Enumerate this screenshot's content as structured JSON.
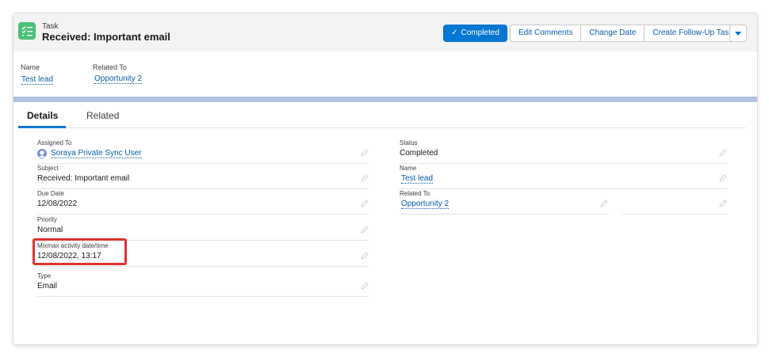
{
  "header": {
    "object_type": "Task",
    "title": "Received: Important email",
    "actions": {
      "completed": "Completed",
      "edit_comments": "Edit Comments",
      "change_date": "Change Date",
      "create_follow_up": "Create Follow-Up Task"
    }
  },
  "highlights": {
    "name_label": "Name",
    "name_value": "Test lead",
    "related_label": "Related To",
    "related_value": "Opportunity 2"
  },
  "tabs": [
    "Details",
    "Related"
  ],
  "details": {
    "left": [
      {
        "label": "Assigned To",
        "value": "Soraya Private Sync User"
      },
      {
        "label": "Subject",
        "value": "Received: Important email"
      },
      {
        "label": "Due Date",
        "value": "12/08/2022"
      },
      {
        "label": "Priority",
        "value": "Normal"
      },
      {
        "label": "Mixmax activity date/time",
        "value": "12/08/2022, 13:17"
      },
      {
        "label": "Type",
        "value": "Email"
      }
    ],
    "right": [
      {
        "label": "Status",
        "value": "Completed"
      },
      {
        "label": "Name",
        "value": "Test lead"
      },
      {
        "label": "Related To",
        "value": "Opportunity 2"
      }
    ]
  },
  "colors": {
    "brand": "#0176d3",
    "link": "#0b5cab",
    "task_icon": "#4bc076",
    "annotation": "#e0312d"
  },
  "icons": {
    "task": "task-checklist-icon",
    "completed_check": "check-icon",
    "more_actions": "chevron-down-icon",
    "edit": "pencil-icon",
    "user": "user-avatar-icon"
  }
}
